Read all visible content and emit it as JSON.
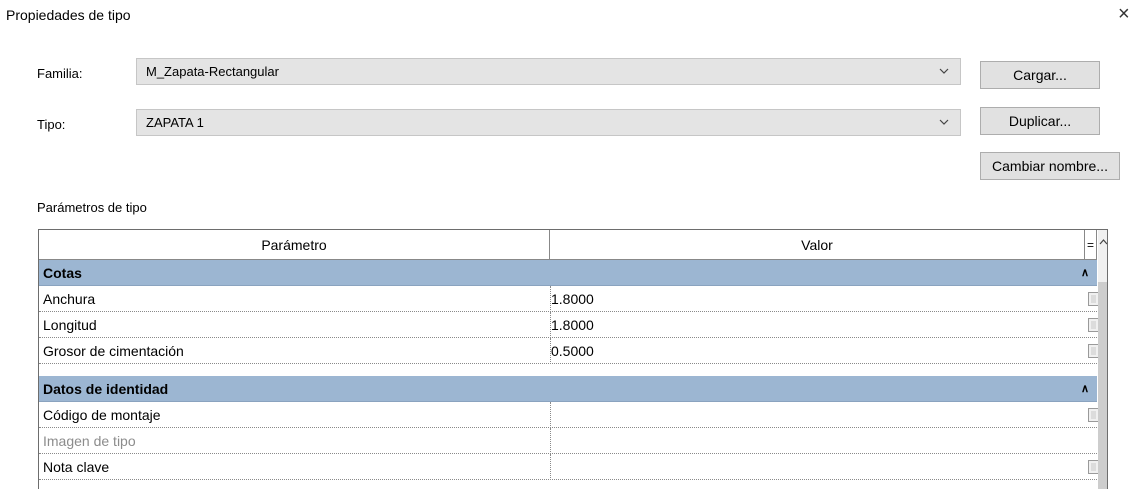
{
  "window": {
    "title": "Propiedades de tipo",
    "close_label": "×"
  },
  "family": {
    "label": "Familia:",
    "value": "M_Zapata-Rectangular"
  },
  "type": {
    "label": "Tipo:",
    "value": "ZAPATA 1"
  },
  "buttons": {
    "load": "Cargar...",
    "duplicate": "Duplicar...",
    "rename": "Cambiar nombre..."
  },
  "params": {
    "section_label": "Parámetros de tipo",
    "col_param": "Parámetro",
    "col_value": "Valor",
    "col_eq": "=",
    "groups": [
      {
        "name": "Cotas",
        "rows": [
          {
            "param": "Anchura",
            "value": "1.8000"
          },
          {
            "param": "Longitud",
            "value": "1.8000"
          },
          {
            "param": "Grosor de cimentación",
            "value": "0.5000"
          }
        ]
      },
      {
        "name": "Datos de identidad",
        "rows": [
          {
            "param": "Código de montaje",
            "value": ""
          },
          {
            "param": "Imagen de tipo",
            "value": ""
          },
          {
            "param": "Nota clave",
            "value": ""
          }
        ]
      }
    ]
  }
}
